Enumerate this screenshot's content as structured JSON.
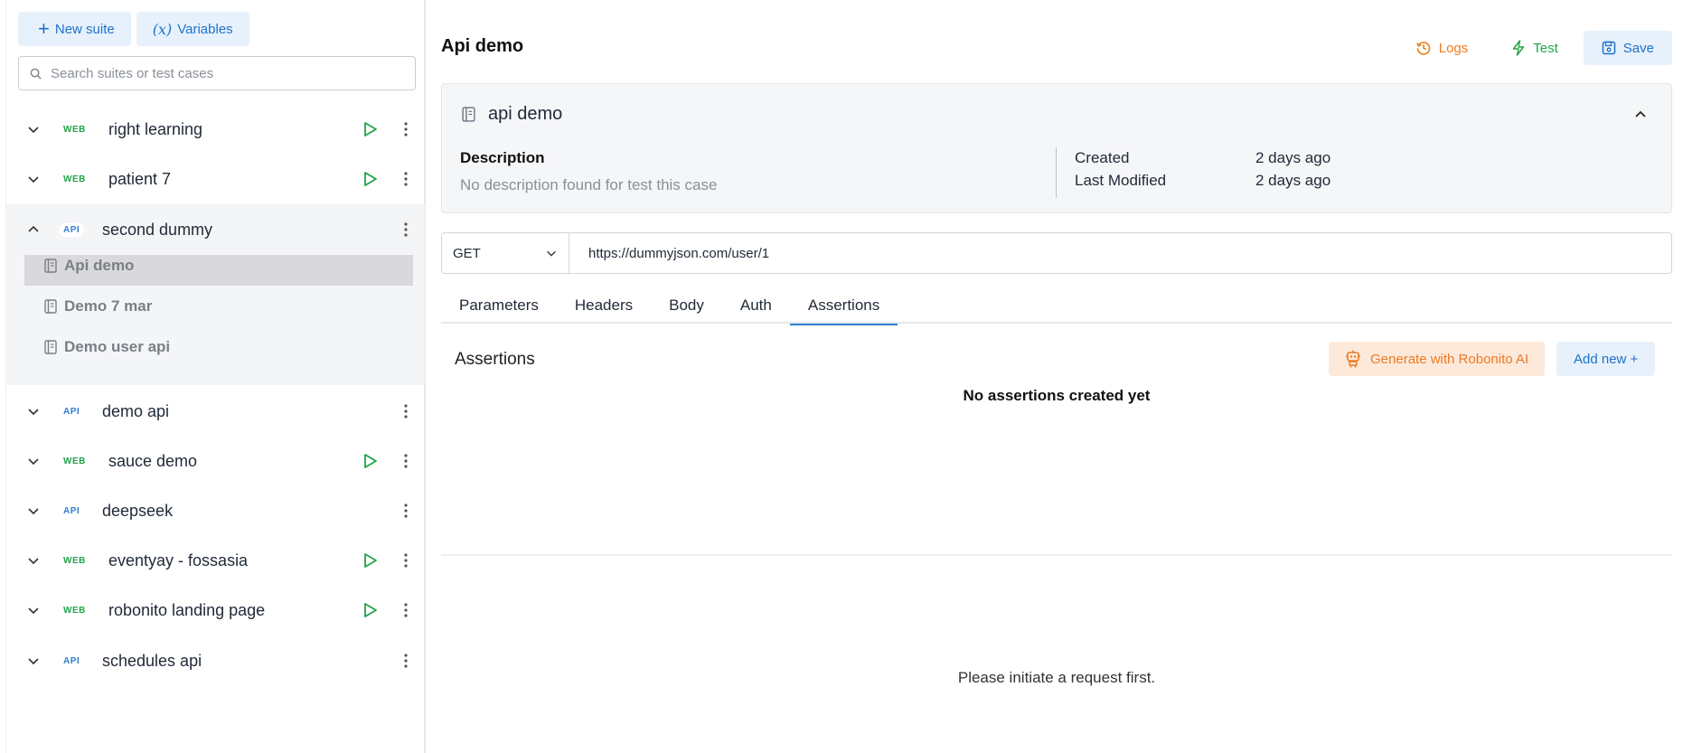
{
  "sidebar": {
    "new_suite_label": "New suite",
    "variables_icon": "(x)",
    "variables_label": "Variables",
    "search_placeholder": "Search suites or test cases",
    "suites": [
      {
        "type": "WEB",
        "name": "right learning",
        "expanded": false,
        "runnable": true
      },
      {
        "type": "WEB",
        "name": "patient 7",
        "expanded": false,
        "runnable": true
      },
      {
        "type": "API",
        "name": "second dummy",
        "expanded": true,
        "runnable": false
      },
      {
        "type": "API",
        "name": "demo api",
        "expanded": false,
        "runnable": false
      },
      {
        "type": "WEB",
        "name": "sauce demo",
        "expanded": false,
        "runnable": true
      },
      {
        "type": "API",
        "name": "deepseek",
        "expanded": false,
        "runnable": false
      },
      {
        "type": "WEB",
        "name": "eventyay - fossasia",
        "expanded": false,
        "runnable": true
      },
      {
        "type": "WEB",
        "name": "robonito landing page",
        "expanded": false,
        "runnable": true
      },
      {
        "type": "API",
        "name": "schedules api",
        "expanded": false,
        "runnable": false
      }
    ],
    "expanded_cases": [
      {
        "name": "Api demo",
        "active": true
      },
      {
        "name": "Demo 7 mar",
        "active": false
      },
      {
        "name": "Demo user api",
        "active": false
      }
    ]
  },
  "header": {
    "title": "Api demo",
    "logs_label": "Logs",
    "test_label": "Test",
    "save_label": "Save"
  },
  "info": {
    "case_name": "api demo",
    "description_label": "Description",
    "description_text": "No description found for test this case",
    "created_label": "Created",
    "created_value": "2 days ago",
    "modified_label": "Last Modified",
    "modified_value": "2 days ago"
  },
  "request": {
    "method": "GET",
    "url": "https://dummyjson.com/user/1"
  },
  "tabs": [
    {
      "label": "Parameters",
      "active": false
    },
    {
      "label": "Headers",
      "active": false
    },
    {
      "label": "Body",
      "active": false
    },
    {
      "label": "Auth",
      "active": false
    },
    {
      "label": "Assertions",
      "active": true
    }
  ],
  "assertions": {
    "title": "Assertions",
    "generate_label": "Generate with Robonito AI",
    "add_label": "Add new +",
    "empty_text": "No assertions created yet"
  },
  "response": {
    "empty_text": "Please initiate a request first."
  },
  "colors": {
    "accent_blue": "#1e73c8",
    "web_green": "#22a34a",
    "api_blue": "#2f7fd6",
    "logs_orange": "#f07b1a",
    "ai_orange": "#ea7a24"
  }
}
